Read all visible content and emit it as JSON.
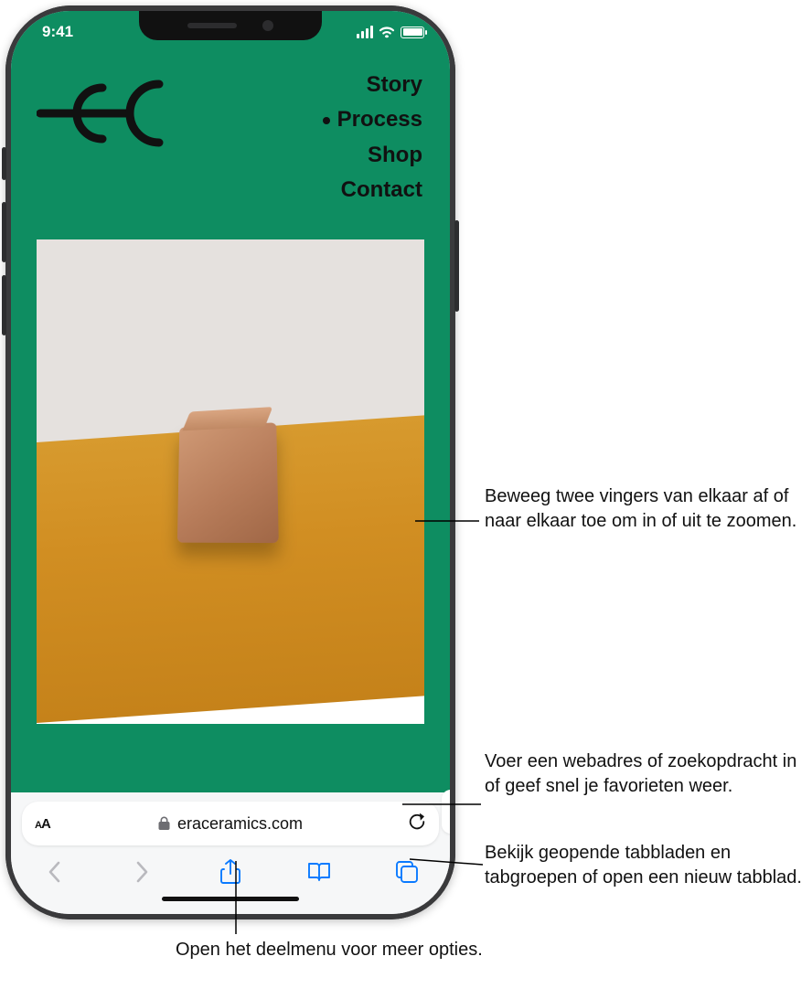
{
  "statusbar": {
    "time": "9:41"
  },
  "webpage": {
    "nav": {
      "items": [
        {
          "label": "Story",
          "active": false
        },
        {
          "label": "Process",
          "active": true
        },
        {
          "label": "Shop",
          "active": false
        },
        {
          "label": "Contact",
          "active": false
        }
      ]
    }
  },
  "addressbar": {
    "text_size_label": "AA",
    "url": "eraceramics.com"
  },
  "callouts": {
    "zoom": "Beweeg twee vingers van elkaar af of naar elkaar toe om in of uit te zoomen.",
    "address": "Voer een webadres of zoekopdracht in of geef snel je favorieten weer.",
    "tabs": "Bekijk geopende tabbladen en tabgroepen of open een nieuw tabblad.",
    "share": "Open het deelmenu voor meer opties."
  }
}
